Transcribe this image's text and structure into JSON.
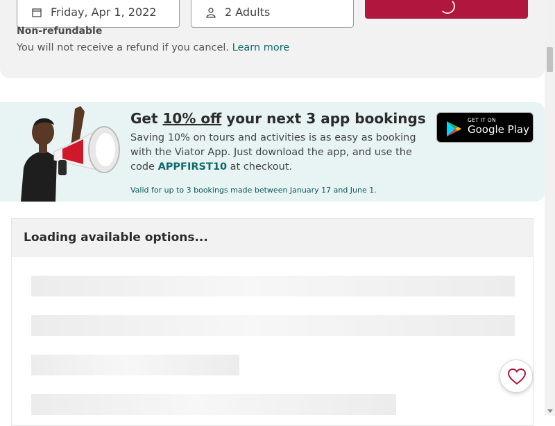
{
  "booking": {
    "date_value": "Friday, Apr 1, 2022",
    "guests_value": "2 Adults",
    "policy_title": "Non-refundable",
    "policy_text": "You will not receive a refund if you cancel.",
    "policy_link": "Learn more"
  },
  "promo": {
    "title_prefix": "Get",
    "title_highlight": "10% off",
    "title_suffix": "your next 3 app bookings",
    "body_prefix": "Saving 10% on tours and activities is as easy as booking with the Viator App. Just download the app, and use the code",
    "promo_code": "APPFIRST10",
    "body_suffix": "at checkout.",
    "note": "Valid for up to 3 bookings made between January 17 and June 1.",
    "badge_small": "GET IT ON",
    "badge_big": "Google Play"
  },
  "options": {
    "title": "Loading available options..."
  },
  "colors": {
    "brand": "#b0163e",
    "teal": "#0e6a6a",
    "promo_bg": "#e8f3f3"
  }
}
